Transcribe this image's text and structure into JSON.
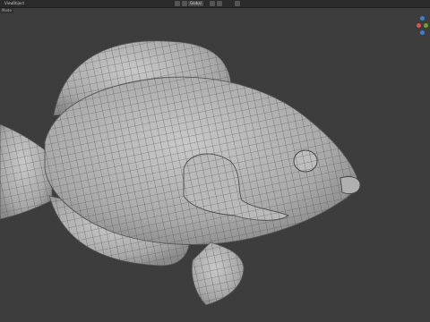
{
  "header": {
    "menus": [
      "View",
      "Object"
    ],
    "transform_orientation": "Global",
    "tool_label": "Mode"
  },
  "viewport": {
    "background": "#3d3d3d",
    "mesh_color": "#b5b5b5",
    "wire_color": "#505050"
  },
  "gizmo": {
    "x_color": "#e0524f",
    "y_color": "#6aa62c",
    "z_color": "#3d7fd1"
  }
}
